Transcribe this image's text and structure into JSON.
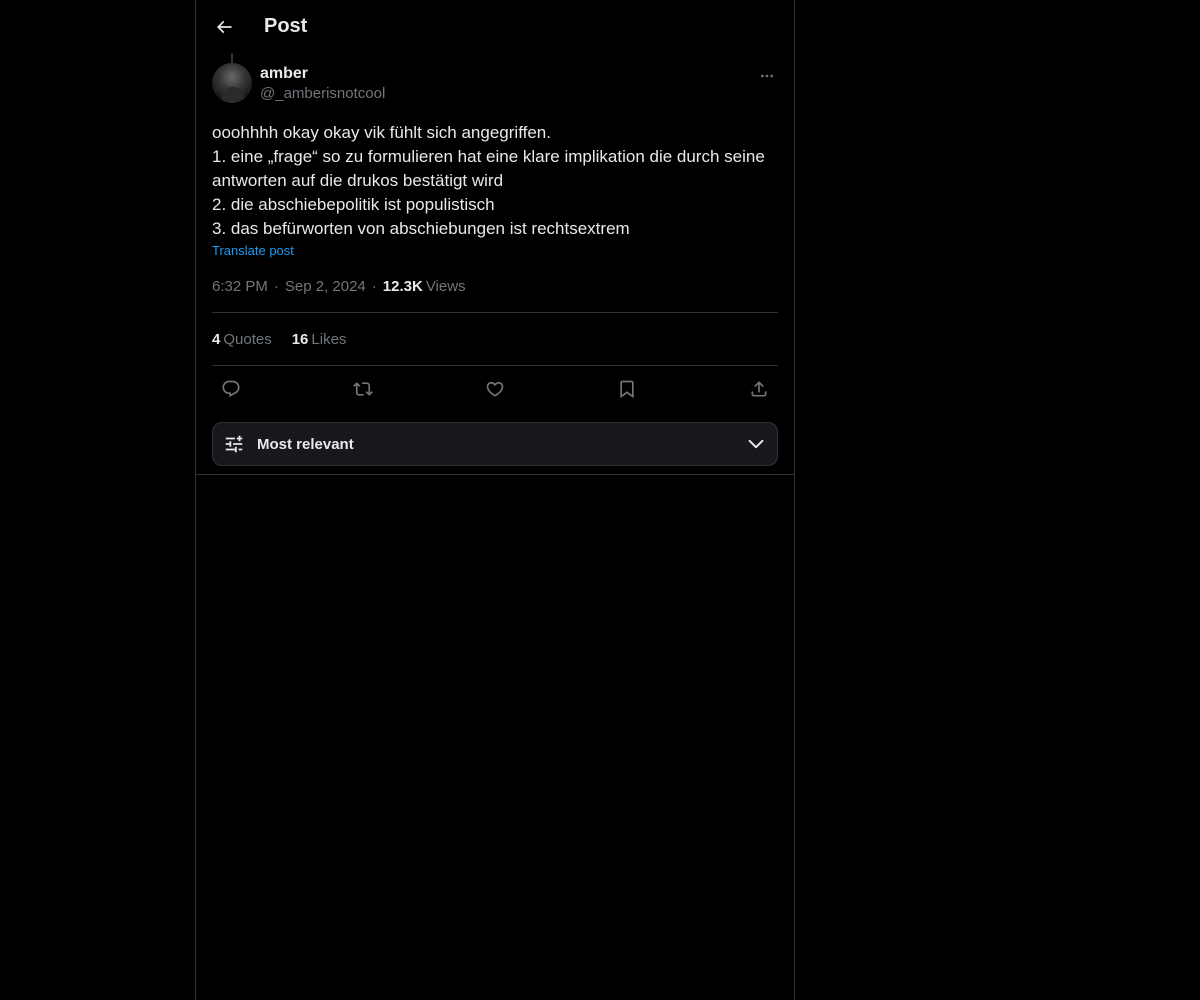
{
  "header": {
    "title": "Post",
    "back_icon": "arrow-left-icon"
  },
  "post": {
    "author": {
      "display_name": "amber",
      "handle": "@_amberisnotcool",
      "avatar_icon": "avatar"
    },
    "more_icon": "more-horizontal-icon",
    "text": "ooohhhh okay okay vik fühlt sich angegriffen.\n1. eine „frage“ so zu formulieren hat eine klare implikation die durch seine antworten auf die drukos bestätigt wird\n2. die abschiebepolitik ist populistisch\n3. das befürworten von abschiebungen ist rechtsextrem",
    "translate_label": "Translate post",
    "time": "6:32 PM",
    "date": "Sep 2, 2024",
    "separator": "·",
    "views_count": "12.3K",
    "views_label": "Views"
  },
  "stats": {
    "quotes_count": "4",
    "quotes_label": "Quotes",
    "likes_count": "16",
    "likes_label": "Likes"
  },
  "actions": [
    {
      "name": "reply-icon"
    },
    {
      "name": "repost-icon"
    },
    {
      "name": "like-icon"
    },
    {
      "name": "bookmark-icon"
    },
    {
      "name": "share-icon"
    }
  ],
  "sort": {
    "label": "Most relevant",
    "icon": "sliders-icon",
    "chevron": "chevron-down-icon"
  },
  "colors": {
    "background": "#000000",
    "text_primary": "#e7e9ea",
    "text_secondary": "#71767b",
    "link": "#1d9bf0",
    "border": "#2f3336"
  }
}
